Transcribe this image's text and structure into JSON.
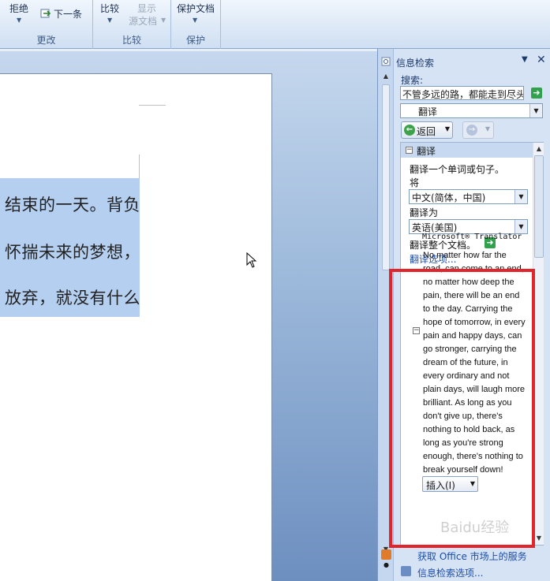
{
  "ribbon": {
    "groups": [
      {
        "label": "更改",
        "buttons": [
          "拒绝",
          "下一条"
        ]
      },
      {
        "label": "比较",
        "buttons": [
          "比较",
          "显示",
          "源文档"
        ]
      },
      {
        "label": "保护",
        "buttons": [
          "保护文档"
        ]
      }
    ]
  },
  "document": {
    "lines": [
      "结束的一天。背负",
      "怀揣未来的梦想，",
      "放弃，就没有什么"
    ]
  },
  "research_pane": {
    "title": "信息检索",
    "search_label": "搜索:",
    "search_value": "不管多远的路，都能走到尽头",
    "service": "翻译",
    "back_label": "返回",
    "section_title": "翻译",
    "translate_hint": "翻译一个单词或句子。",
    "from_label": "将",
    "from_lang": "中文(简体，中国)",
    "to_label": "翻译为",
    "to_lang": "英语(美国)",
    "translate_doc": "翻译整个文档。",
    "translate_options": "翻译选项...",
    "translator_title": "Microsoft® Translator",
    "translation_lines": [
      "No matter how far the",
      "road, can come to an end,",
      "no matter how deep the",
      "pain, there will be an end",
      "to the day. Carrying the",
      "hope of tomorrow, in every",
      "pain and happy days, can",
      "go stronger, carrying the",
      "dream of the future, in",
      "every ordinary and not",
      "plain days, will laugh more",
      "brilliant. As long as you",
      "don't give up, there's",
      "nothing to hold back, as",
      "long as you're strong",
      "enough, there's nothing to",
      "break yourself down!"
    ],
    "insert_label": "插入(I)",
    "office_market": "获取 Office 市场上的服务",
    "research_options": "信息检索选项..."
  },
  "watermark": "Baidu经验",
  "colors": {
    "highlight": "#b4cff0",
    "red_box": "#e2242b",
    "link": "#1f4ea6"
  }
}
